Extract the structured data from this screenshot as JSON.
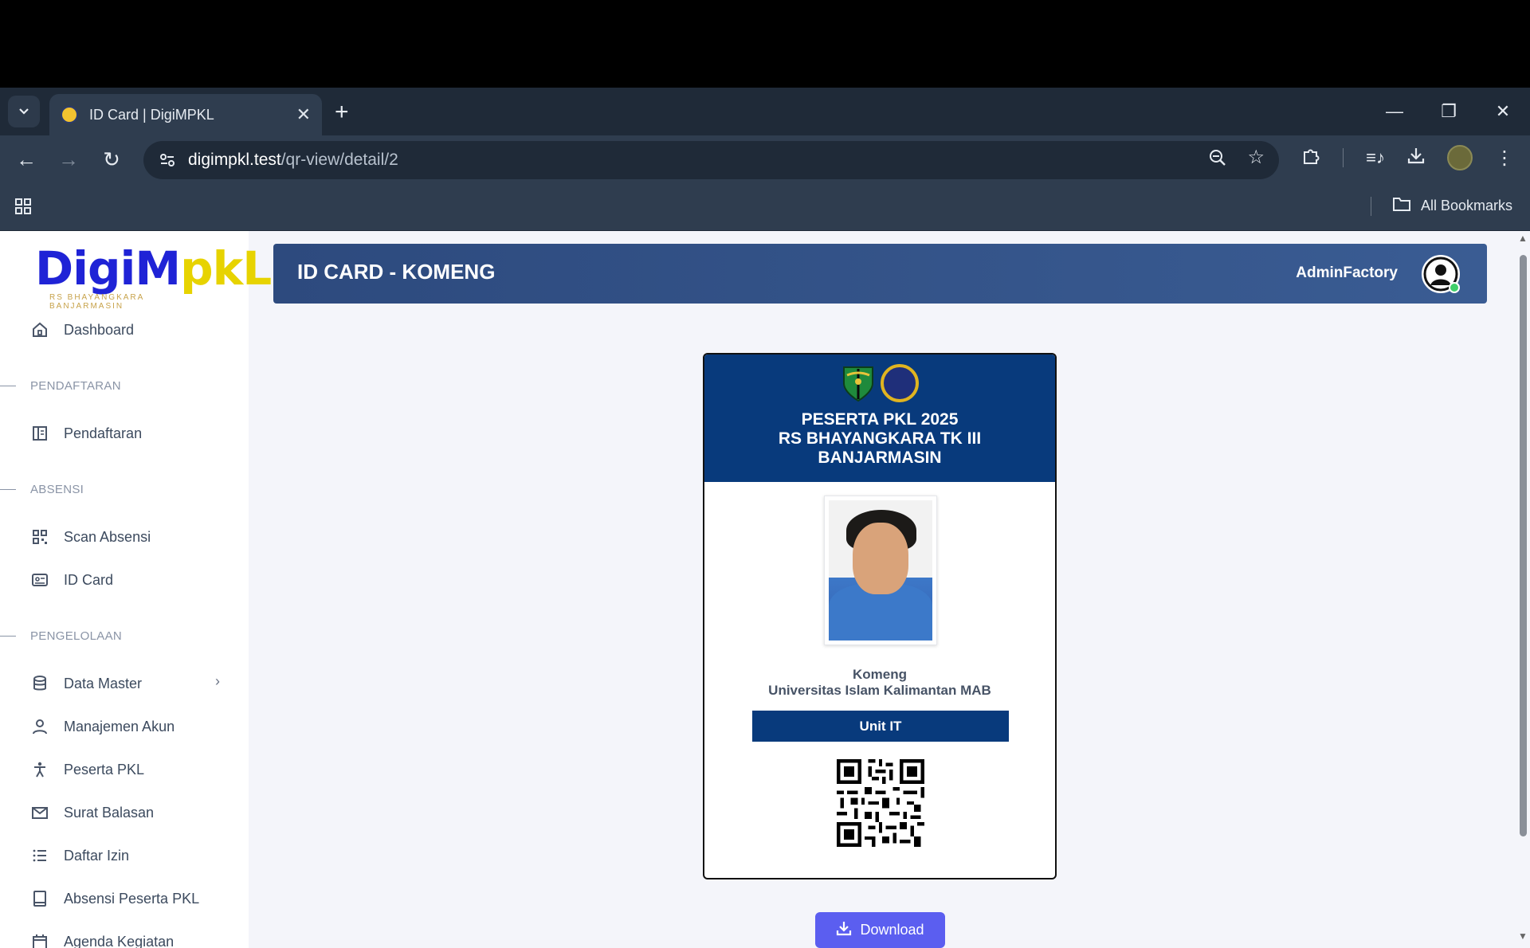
{
  "browser": {
    "tab_title": "ID Card | DigiMPKL",
    "url_host": "digimpkl.test",
    "url_path": "/qr-view/detail/2",
    "all_bookmarks": "All Bookmarks"
  },
  "sidebar": {
    "logo_text_a": "DigiM",
    "logo_text_b": "pkL",
    "logo_sub": "RS BHAYANGKARA BANJARMASIN",
    "items": [
      {
        "label": "Dashboard",
        "icon": "home-icon"
      },
      {
        "label": "PENDAFTARAN",
        "type": "header"
      },
      {
        "label": "Pendaftaran",
        "icon": "layout-icon"
      },
      {
        "label": "ABSENSI",
        "type": "header"
      },
      {
        "label": "Scan Absensi",
        "icon": "scan-icon"
      },
      {
        "label": "ID Card",
        "icon": "id-card-icon"
      },
      {
        "label": "PENGELOLAAN",
        "type": "header"
      },
      {
        "label": "Data Master",
        "icon": "database-icon"
      },
      {
        "label": "Manajemen Akun",
        "icon": "user-icon"
      },
      {
        "label": "Peserta PKL",
        "icon": "person-icon"
      },
      {
        "label": "Surat Balasan",
        "icon": "mail-icon"
      },
      {
        "label": "Daftar Izin",
        "icon": "list-icon"
      },
      {
        "label": "Absensi Peserta PKL",
        "icon": "book-icon"
      },
      {
        "label": "Agenda Kegiatan",
        "icon": "calendar-icon"
      }
    ]
  },
  "header": {
    "title": "ID CARD - KOMENG",
    "username": "AdminFactory"
  },
  "card": {
    "line1": "PESERTA PKL 2025",
    "line2": "RS BHAYANGKARA TK III",
    "line3": "BANJARMASIN",
    "name": "Komeng",
    "school": "Universitas Islam Kalimantan MAB",
    "unit": "Unit IT"
  },
  "download_label": "Download",
  "colors": {
    "card_blue": "#083a7c",
    "header_blue": "#2d4a7e",
    "download_purple": "#5b5ef0"
  }
}
